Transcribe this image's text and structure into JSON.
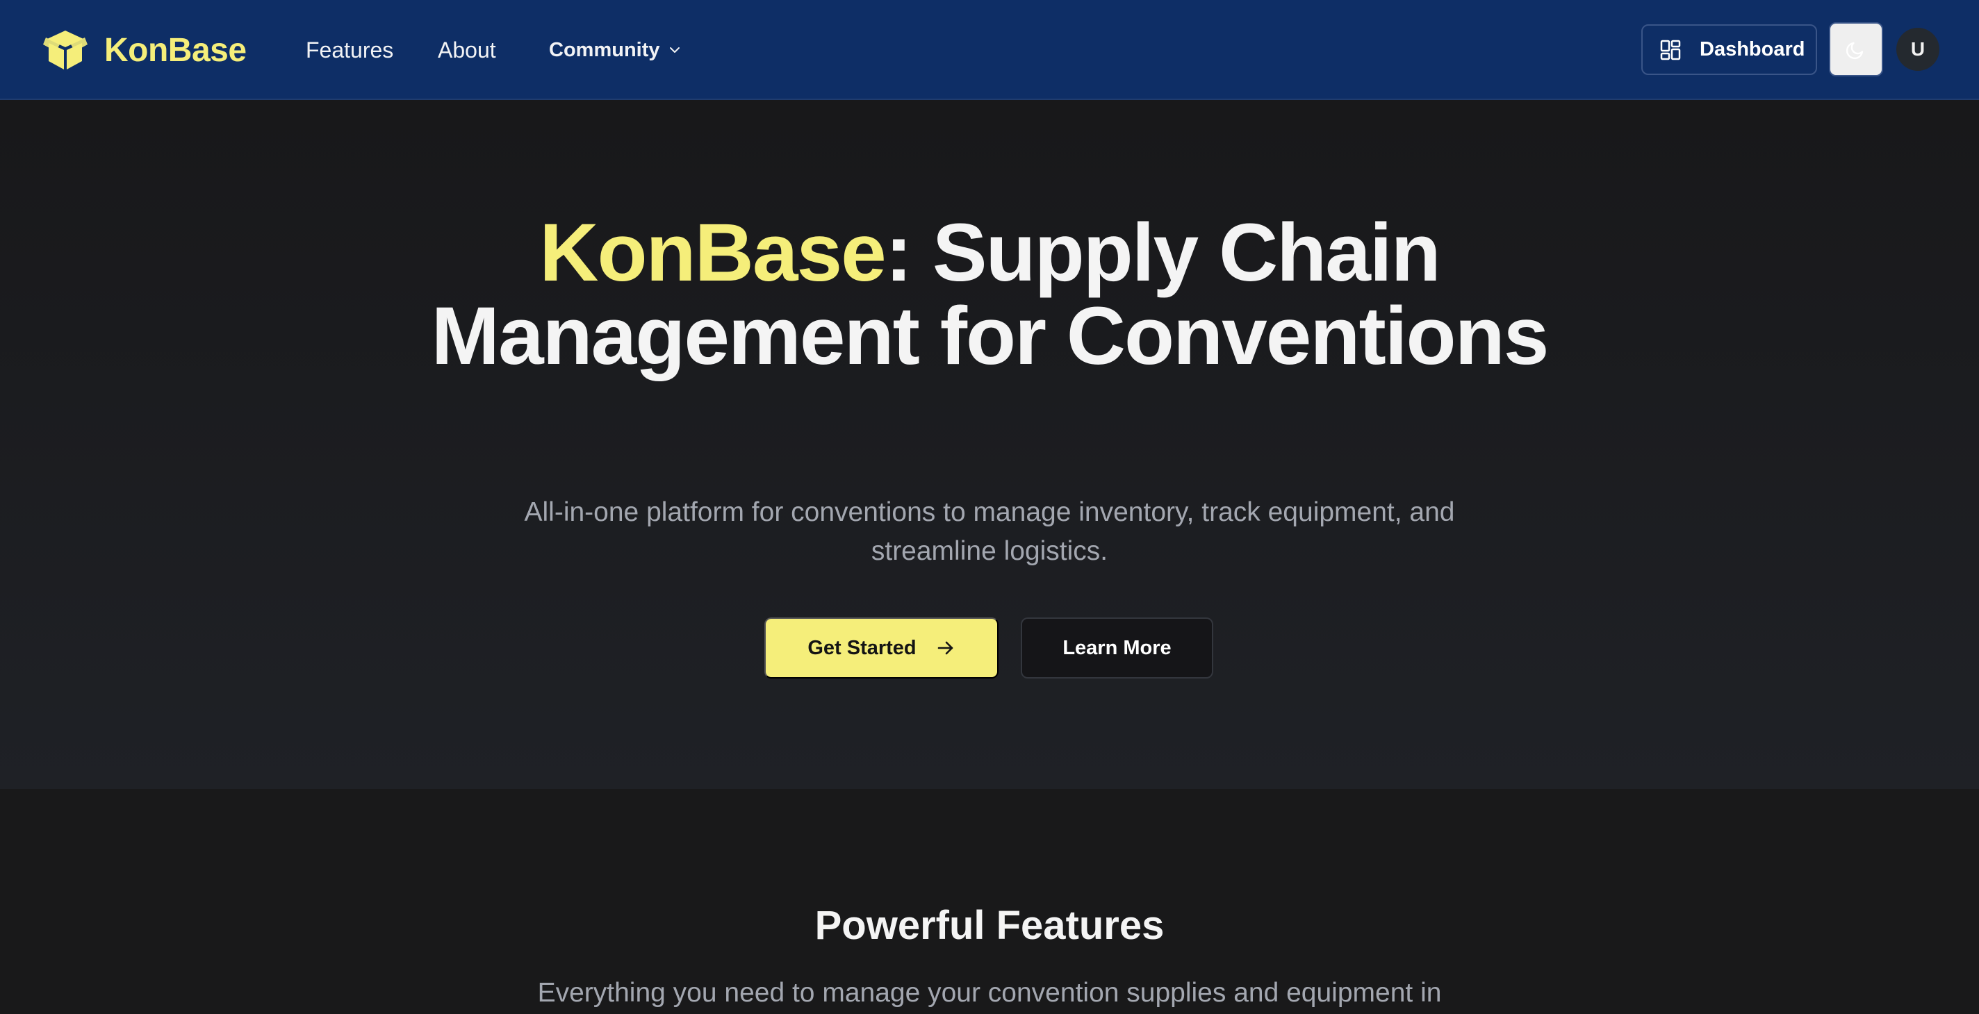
{
  "nav": {
    "brand": "KonBase",
    "logo_icon": "box-icon",
    "links": [
      "Features",
      "About"
    ],
    "community": "Community",
    "dashboard": "Dashboard",
    "theme_icon": "moon-icon",
    "avatar_initial": "U"
  },
  "hero": {
    "title_accent": "KonBase",
    "title_rest": ": Supply Chain Management for Conventions",
    "subtitle": "All-in-one platform for conventions to manage inventory, track equipment, and streamline logistics.",
    "cta_primary": "Get Started",
    "cta_secondary": "Learn More"
  },
  "features": {
    "title": "Powerful Features",
    "subtitle": "Everything you need to manage your convention supplies and equipment in"
  },
  "colors": {
    "header_bg": "#0e2e66",
    "accent": "#f5ee7a",
    "page_bg": "#1a1a1b",
    "muted_text": "#a3a7b0"
  }
}
